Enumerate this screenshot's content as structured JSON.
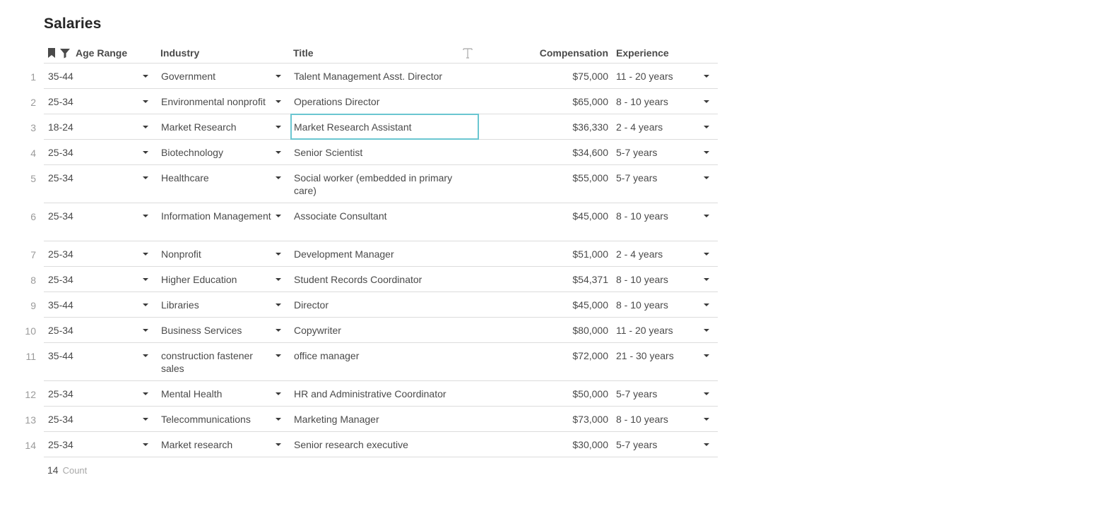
{
  "page": {
    "title": "Salaries"
  },
  "table": {
    "columns": {
      "age_range": "Age Range",
      "industry": "Industry",
      "title": "Title",
      "compensation": "Compensation",
      "experience": "Experience"
    },
    "header_icons": [
      "bookmark-icon",
      "filter-icon",
      "text-type-icon"
    ],
    "selected_cell": {
      "row": 3,
      "column": "title"
    },
    "selection_color": "#6ac6d1",
    "rows": [
      {
        "num": "1",
        "age": "35-44",
        "industry": "Government",
        "title": "Talent Management Asst. Director",
        "comp": "$75,000",
        "exp": "11 - 20 years"
      },
      {
        "num": "2",
        "age": "25-34",
        "industry": "Environmental nonprofit",
        "title": "Operations Director",
        "comp": "$65,000",
        "exp": "8 - 10 years"
      },
      {
        "num": "3",
        "age": "18-24",
        "industry": "Market Research",
        "title": "Market Research Assistant",
        "comp": "$36,330",
        "exp": "2 - 4 years"
      },
      {
        "num": "4",
        "age": "25-34",
        "industry": "Biotechnology",
        "title": "Senior Scientist",
        "comp": "$34,600",
        "exp": "5-7 years"
      },
      {
        "num": "5",
        "age": "25-34",
        "industry": "Healthcare",
        "title": "Social worker (embedded in primary care)",
        "comp": "$55,000",
        "exp": "5-7 years"
      },
      {
        "num": "6",
        "age": "25-34",
        "industry": "Information Management",
        "title": "Associate Consultant",
        "comp": "$45,000",
        "exp": "8 - 10 years"
      },
      {
        "num": "7",
        "age": "25-34",
        "industry": "Nonprofit",
        "title": "Development Manager",
        "comp": "$51,000",
        "exp": "2 - 4 years"
      },
      {
        "num": "8",
        "age": "25-34",
        "industry": "Higher Education",
        "title": "Student Records Coordinator",
        "comp": "$54,371",
        "exp": "8 - 10 years"
      },
      {
        "num": "9",
        "age": "35-44",
        "industry": "Libraries",
        "title": "Director",
        "comp": "$45,000",
        "exp": "8 - 10 years"
      },
      {
        "num": "10",
        "age": "25-34",
        "industry": "Business Services",
        "title": "Copywriter",
        "comp": "$80,000",
        "exp": "11 - 20 years"
      },
      {
        "num": "11",
        "age": "35-44",
        "industry": "construction fastener sales",
        "title": "office manager",
        "comp": "$72,000",
        "exp": "21 - 30 years"
      },
      {
        "num": "12",
        "age": "25-34",
        "industry": "Mental Health",
        "title": "HR and Administrative Coordinator",
        "comp": "$50,000",
        "exp": "5-7 years"
      },
      {
        "num": "13",
        "age": "25-34",
        "industry": "Telecommunications",
        "title": "Marketing Manager",
        "comp": "$73,000",
        "exp": "8 - 10 years"
      },
      {
        "num": "14",
        "age": "25-34",
        "industry": "Market research",
        "title": "Senior research executive",
        "comp": "$30,000",
        "exp": "5-7 years"
      }
    ]
  },
  "footer": {
    "count_value": "14",
    "count_label": "Count"
  }
}
